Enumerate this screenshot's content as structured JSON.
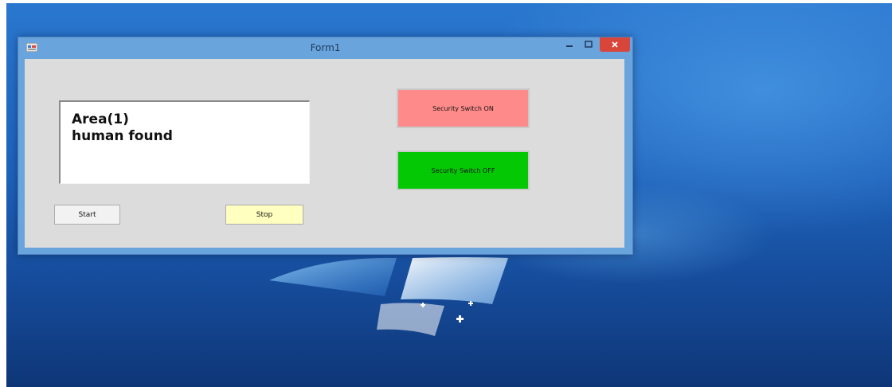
{
  "window": {
    "title": "Form1",
    "minimize_icon": "minimize-icon",
    "maximize_icon": "maximize-icon",
    "close_icon": "close-icon",
    "app_icon": "form-app-icon"
  },
  "form": {
    "output_lines": [
      "Area(1)",
      "human found"
    ],
    "start_label": "Start",
    "stop_label": "Stop",
    "switch_on_label": "Security Switch ON",
    "switch_off_label": "Security Switch OFF"
  },
  "colors": {
    "client_background": "#dcdcdc",
    "stop_button": "#ffffc0",
    "switch_on_button": "#ff8a8a",
    "switch_off_button": "#05c805",
    "close_button": "#d8453b",
    "window_frame": "#6aa4dd"
  }
}
